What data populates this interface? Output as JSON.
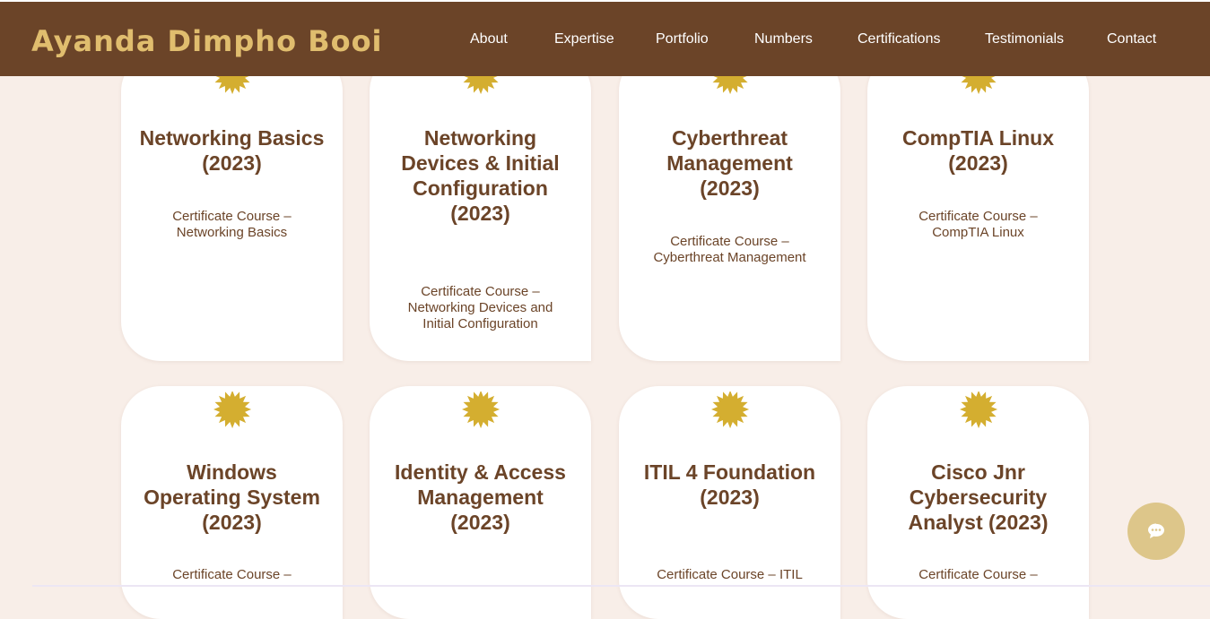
{
  "brand": "Ayanda Dimpho Booi",
  "nav": [
    "About",
    "Expertise",
    "Portfolio",
    "Numbers",
    "Certifications",
    "Testimonials",
    "Contact"
  ],
  "cards": [
    {
      "title": "Networking Basics (2023)",
      "desc": "Certificate Course – Networking Basics",
      "icon": "badge-icon"
    },
    {
      "title": "Networking Devices & Initial Configuration (2023)",
      "desc": "Certificate Course – Networking Devices and Initial Configuration",
      "icon": "badge-icon"
    },
    {
      "title": "Cyberthreat Management (2023)",
      "desc": "Certificate Course – Cyberthreat Management",
      "icon": "badge-icon"
    },
    {
      "title": "CompTIA Linux (2023)",
      "desc": "Certificate Course – CompTIA Linux",
      "icon": "badge-icon"
    },
    {
      "title": "Windows Operating System (2023)",
      "desc": "Certificate Course –",
      "icon": "badge-icon"
    },
    {
      "title": "Identity & Access Management (2023)",
      "desc": "",
      "icon": "badge-icon"
    },
    {
      "title": "ITIL 4 Foundation (2023)",
      "desc": "Certificate Course – ITIL",
      "icon": "badge-icon"
    },
    {
      "title": "Cisco Jnr Cybersecurity Analyst (2023)",
      "desc": "Certificate Course –",
      "icon": "badge-icon"
    }
  ],
  "chat": {
    "icon": "chat-icon"
  },
  "colors": {
    "header": "#6b4428",
    "brand": "#e0bd6e",
    "background": "#f8eee8",
    "card": "#ffffff",
    "text": "#6b4428",
    "badge": "#d4ae30",
    "chat": "#ddc68a"
  }
}
